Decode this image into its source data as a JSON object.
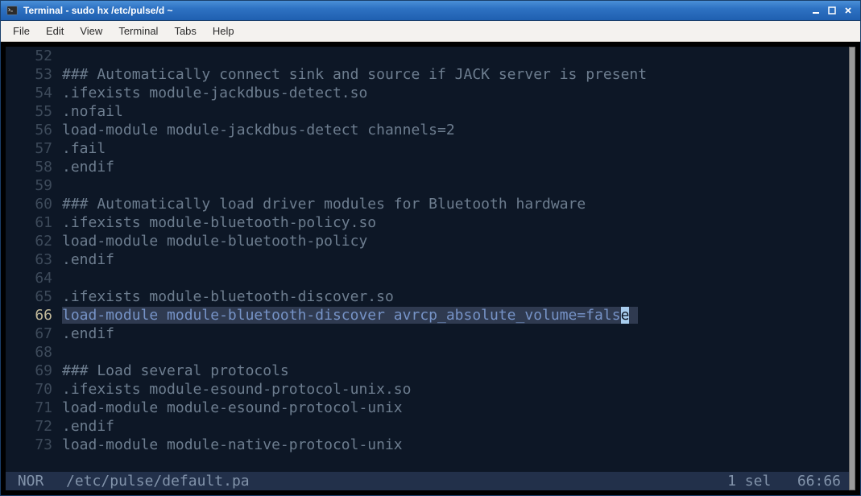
{
  "window": {
    "title": "Terminal - sudo hx /etc/pulse/d ~"
  },
  "menubar": [
    "File",
    "Edit",
    "View",
    "Terminal",
    "Tabs",
    "Help"
  ],
  "editor": {
    "lines": [
      {
        "num": 52,
        "text": ""
      },
      {
        "num": 53,
        "text": "### Automatically connect sink and source if JACK server is present"
      },
      {
        "num": 54,
        "text": ".ifexists module-jackdbus-detect.so"
      },
      {
        "num": 55,
        "text": ".nofail"
      },
      {
        "num": 56,
        "text": "load-module module-jackdbus-detect channels=2"
      },
      {
        "num": 57,
        "text": ".fail"
      },
      {
        "num": 58,
        "text": ".endif"
      },
      {
        "num": 59,
        "text": ""
      },
      {
        "num": 60,
        "text": "### Automatically load driver modules for Bluetooth hardware"
      },
      {
        "num": 61,
        "text": ".ifexists module-bluetooth-policy.so"
      },
      {
        "num": 62,
        "text": "load-module module-bluetooth-policy"
      },
      {
        "num": 63,
        "text": ".endif"
      },
      {
        "num": 64,
        "text": ""
      },
      {
        "num": 65,
        "text": ".ifexists module-bluetooth-discover.so"
      },
      {
        "num": 66,
        "text": "load-module module-bluetooth-discover avrcp_absolute_volume=false",
        "selected": true
      },
      {
        "num": 67,
        "text": ".endif"
      },
      {
        "num": 68,
        "text": ""
      },
      {
        "num": 69,
        "text": "### Load several protocols"
      },
      {
        "num": 70,
        "text": ".ifexists module-esound-protocol-unix.so"
      },
      {
        "num": 71,
        "text": "load-module module-esound-protocol-unix"
      },
      {
        "num": 72,
        "text": ".endif"
      },
      {
        "num": 73,
        "text": "load-module module-native-protocol-unix"
      }
    ],
    "current_line": 66
  },
  "status": {
    "mode": "NOR",
    "file": "/etc/pulse/default.pa",
    "selection": "1 sel",
    "position": "66:66"
  }
}
